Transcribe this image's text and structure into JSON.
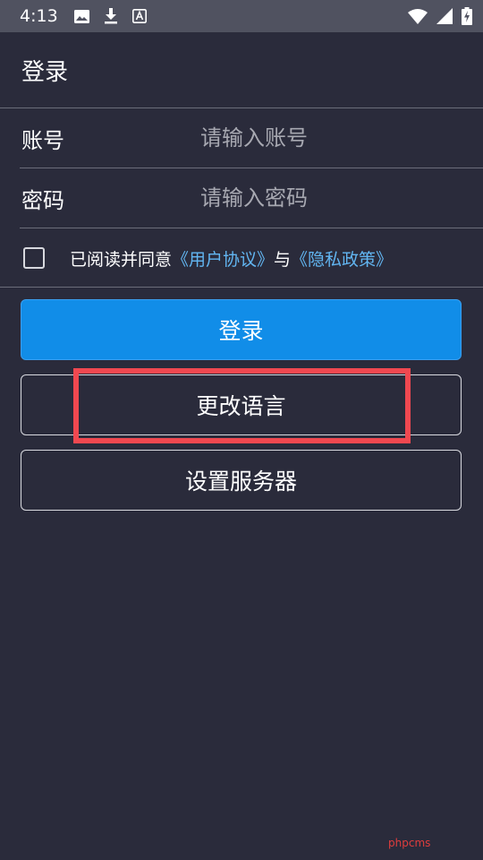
{
  "status_bar": {
    "time": "4:13",
    "icons_left": [
      "image-icon",
      "download-icon",
      "font-a-icon"
    ],
    "icons_right": [
      "wifi-icon",
      "signal-icon",
      "battery-charging-icon"
    ]
  },
  "app_bar": {
    "title": "登录"
  },
  "form": {
    "account": {
      "label": "账号",
      "placeholder": "请输入账号"
    },
    "password": {
      "label": "密码",
      "placeholder": "请输入密码"
    },
    "agreement": {
      "prefix": "已阅读并同意",
      "user_agreement": "《用户协议》",
      "conjunction": "与",
      "privacy_policy": "《隐私政策》",
      "checked": false
    }
  },
  "buttons": {
    "login": "登录",
    "change_language": "更改语言",
    "server_settings": "设置服务器"
  },
  "colors": {
    "background": "#2a2b3b",
    "status_bar": "#505260",
    "primary": "#118de8",
    "link": "#62b6f2",
    "highlight": "#f04850"
  },
  "watermark": "phpcms"
}
